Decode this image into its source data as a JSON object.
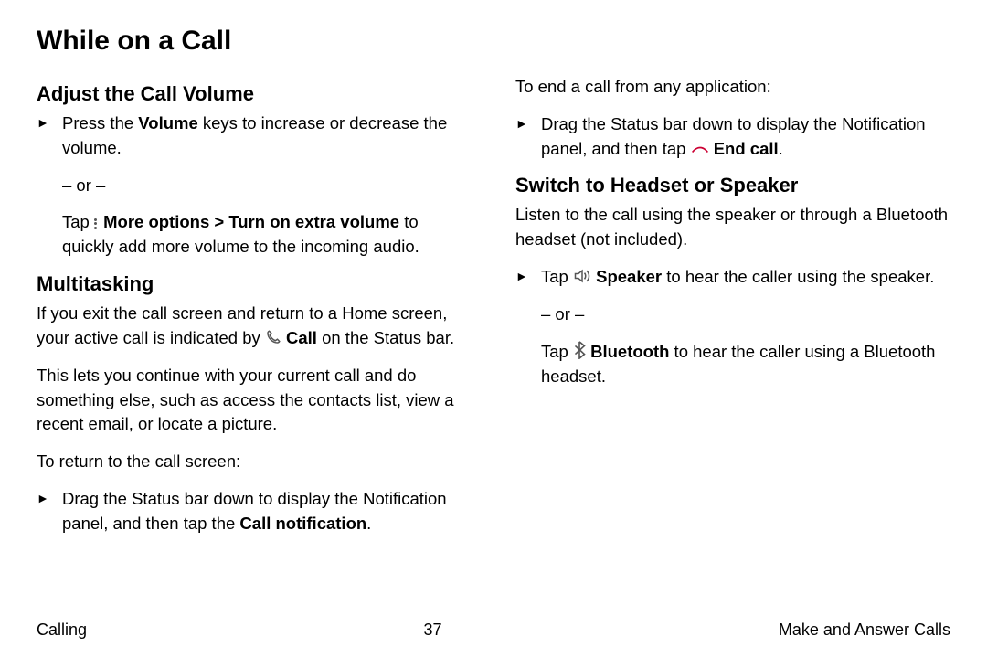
{
  "title": "While on a Call",
  "leftCol": {
    "h2a": "Adjust the Call Volume",
    "vol_a": "Press the ",
    "vol_b": "Volume",
    "vol_c": " keys to increase or decrease the volume.",
    "or": "– or –",
    "tap_a": "Tap ",
    "tap_b": "More options > Turn on extra volume",
    "tap_c": " to quickly add more volume to the incoming audio.",
    "h2b": "Multitasking",
    "multi_a": "If you exit the call screen and return to a Home screen, your active call is indicated by ",
    "multi_b": "Call",
    "multi_c": " on the Status bar.",
    "multi2": "This lets you continue with your current call and do something else, such as access the contacts list, view a recent email, or locate a picture.",
    "return_label": "To return to the call screen:",
    "return_a": "Drag the Status bar down to display the Notification panel, and then tap the ",
    "return_b": "Call notification",
    "return_c": "."
  },
  "rightCol": {
    "end_label": "To end a call from any application:",
    "end_a": "Drag the Status bar down to display the Notification panel, and then tap ",
    "end_b": "End call",
    "end_c": ".",
    "h2c": "Switch to Headset or Speaker",
    "switch_intro": "Listen to the call using the speaker or through a Bluetooth headset (not included).",
    "spk_a": "Tap ",
    "spk_b": "Speaker",
    "spk_c": " to hear the caller using the speaker.",
    "or": "– or –",
    "bt_a": "Tap ",
    "bt_b": "Bluetooth",
    "bt_c": " to hear the caller using a Bluetooth headset."
  },
  "footer": {
    "left": "Calling",
    "center": "37",
    "right": "Make and Answer Calls"
  }
}
